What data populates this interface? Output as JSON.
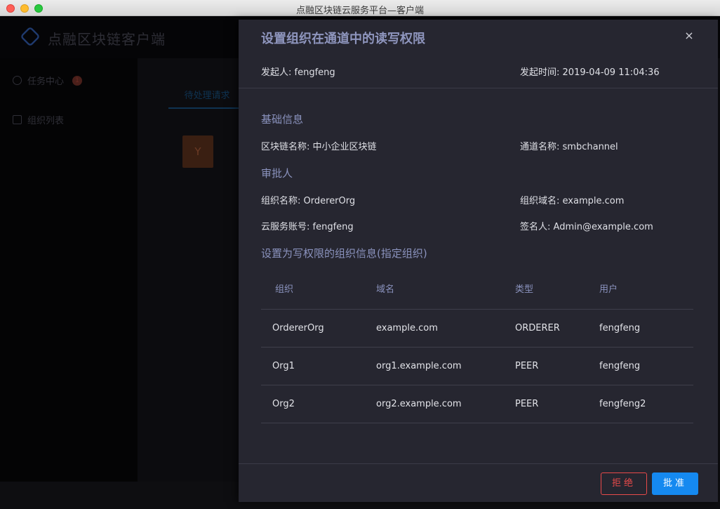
{
  "window": {
    "title": "点融区块链云服务平台—客户端"
  },
  "app": {
    "name": "点融区块链客户端",
    "sidebar": [
      {
        "label": "任务中心",
        "badge": "1"
      },
      {
        "label": "组织列表"
      }
    ],
    "main_tab": "待处理请求",
    "card_letter": "Y"
  },
  "drawer": {
    "title": "设置组织在通道中的读写权限",
    "close_icon": "×",
    "initiator_label": "发起人:",
    "initiator_value": "fengfeng",
    "time_label": "发起时间:",
    "time_value": "2019-04-09 11:04:36",
    "basic_info": {
      "title": "基础信息",
      "chain_label": "区块链名称:",
      "chain_value": "中小企业区块链",
      "channel_label": "通道名称:",
      "channel_value": "smbchannel"
    },
    "approver": {
      "title": "审批人",
      "org_label": "组织名称:",
      "org_value": "OrdererOrg",
      "domain_label": "组织域名:",
      "domain_value": "example.com",
      "account_label": "云服务账号:",
      "account_value": "fengfeng",
      "signer_label": "签名人:",
      "signer_value": "Admin@example.com"
    },
    "write_orgs": {
      "title": "设置为写权限的组织信息(指定组织)",
      "columns": [
        "组织",
        "域名",
        "类型",
        "用户"
      ],
      "rows": [
        [
          "OrdererOrg",
          "example.com",
          "ORDERER",
          "fengfeng"
        ],
        [
          "Org1",
          "org1.example.com",
          "PEER",
          "fengfeng"
        ],
        [
          "Org2",
          "org2.example.com",
          "PEER",
          "fengfeng2"
        ]
      ]
    },
    "reject_label": "拒绝",
    "approve_label": "批准"
  }
}
